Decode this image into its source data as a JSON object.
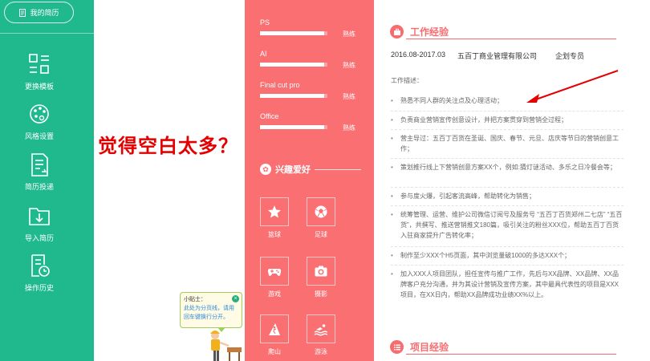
{
  "sidebar": {
    "my_resume": "我的简历",
    "items": [
      {
        "label": "更换模板",
        "icon": "template-grid-icon"
      },
      {
        "label": "风格设置",
        "icon": "palette-icon"
      },
      {
        "label": "简历投递",
        "icon": "send-document-icon"
      },
      {
        "label": "导入简历",
        "icon": "import-folder-icon"
      },
      {
        "label": "操作历史",
        "icon": "history-clock-icon"
      }
    ],
    "color": "#1fb98d"
  },
  "annotation": {
    "question": "觉得空白太多？"
  },
  "tip": {
    "title": "小贴士：",
    "text": "此处为分页线，请用回车键换行分开。"
  },
  "skills": [
    {
      "name": "PS",
      "level": "熟练",
      "fill": 0.95
    },
    {
      "name": "AI",
      "level": "熟练",
      "fill": 0.95
    },
    {
      "name": "Final cut pro",
      "level": "熟练",
      "fill": 0.95
    },
    {
      "name": "Office",
      "level": "熟练",
      "fill": 0.95
    }
  ],
  "hobbies": {
    "title": "兴趣爱好",
    "items": [
      {
        "label": "篮球",
        "icon": "star-icon"
      },
      {
        "label": "足球",
        "icon": "soccer-ball-icon"
      },
      {
        "label": "游戏",
        "icon": "gamepad-icon"
      },
      {
        "label": "摄影",
        "icon": "camera-icon"
      },
      {
        "label": "爬山",
        "icon": "climbing-icon"
      },
      {
        "label": "游泳",
        "icon": "swimming-icon"
      }
    ]
  },
  "work": {
    "title": "工作经验",
    "period": "2016.08-2017.03",
    "company": "五百丁商业管理有限公司",
    "position": "企划专员",
    "desc_label": "工作描述：",
    "bullets": [
      "熟悉不同人群的关注点及心理活动；",
      "负责商业营销宣传创意设计，并把方案贯穿到营销全过程；",
      "营主导过：五百丁百货在圣诞、国庆、春节、元旦、店庆等节日的营销创意工作；",
      "策划推行线上下营销创意方案XX个，例如:猜灯谜活动、多乐之日冷餐会等；",
      "参与度火爆，引起客流高峰，帮助转化为销售；",
      "统筹管理、运营、维护公司微信订阅号及服务号 “五百丁百货郑州二七店” “五百货”，共撰写、推送营销推文180篇，吸引关注的粉丝XXX位，帮助五百丁百货入驻商家提升广告转化率；",
      "制作至少XXX个H5页面，其中浏览量破1000的多达XXX个；",
      "加入XXX人项目团队，担任宣传与推广工作，先后与XX品牌、XX品牌、XX品牌客户充分沟通，并为其设计营销及宣传方案，其中最具代表性的项目是XXX项目，在XX日内，帮助XX品牌成功业绩XX%以上。"
    ]
  },
  "project": {
    "title": "项目经验"
  },
  "colors": {
    "accent_pink": "#fa6f72",
    "section_red": "#f76d6f",
    "annotation_red": "#e40000"
  }
}
